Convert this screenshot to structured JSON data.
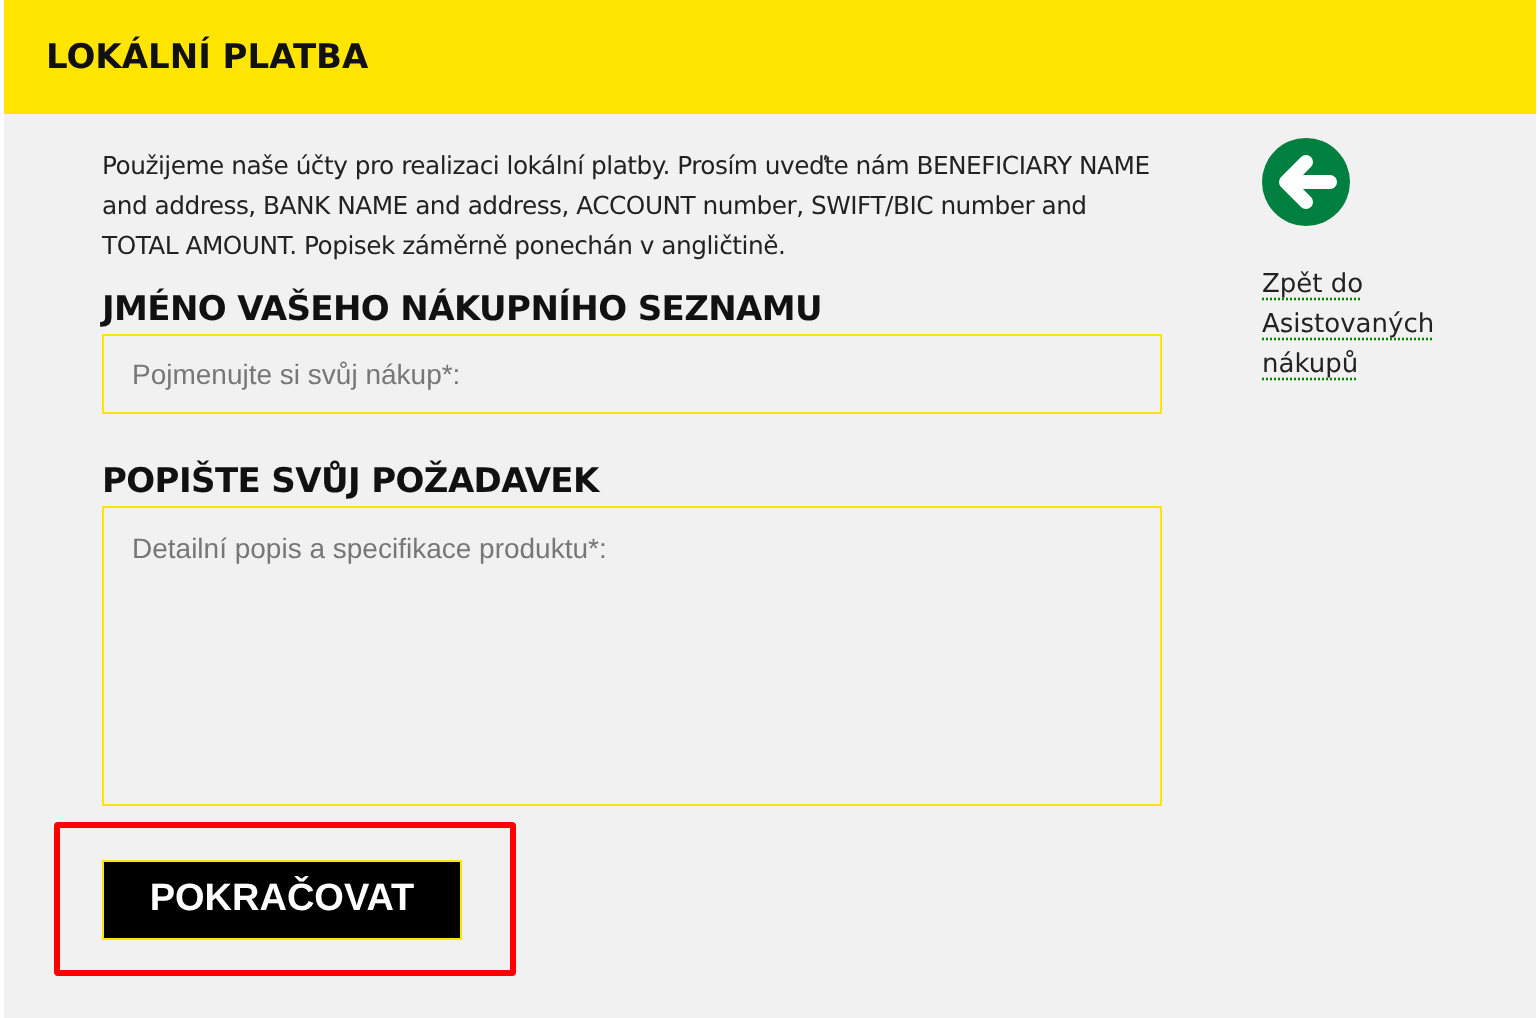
{
  "header": {
    "title": "LOKÁLNÍ PLATBA"
  },
  "intro": "Použijeme naše účty pro realizaci lokální platby. Prosím uveďte nám BENEFICIARY NAME and address, BANK NAME and address, ACCOUNT number, SWIFT/BIC number and TOTAL AMOUNT. Popisek záměrně ponechán v angličtině.",
  "fields": [
    {
      "kind": "input",
      "label": "JMÉNO VAŠEHO NÁKUPNÍHO SEZNAMU",
      "placeholder": "Pojmenujte si svůj nákup*:"
    },
    {
      "kind": "textarea",
      "label": "POPIŠTE SVŮJ POŽADAVEK",
      "placeholder": "Detailní popis a specifikace produktu*:"
    }
  ],
  "submit": {
    "label": "POKRAČOVAT",
    "highlighted": true
  },
  "back_link": {
    "label": "Zpět do Asistovaných nákupů"
  }
}
